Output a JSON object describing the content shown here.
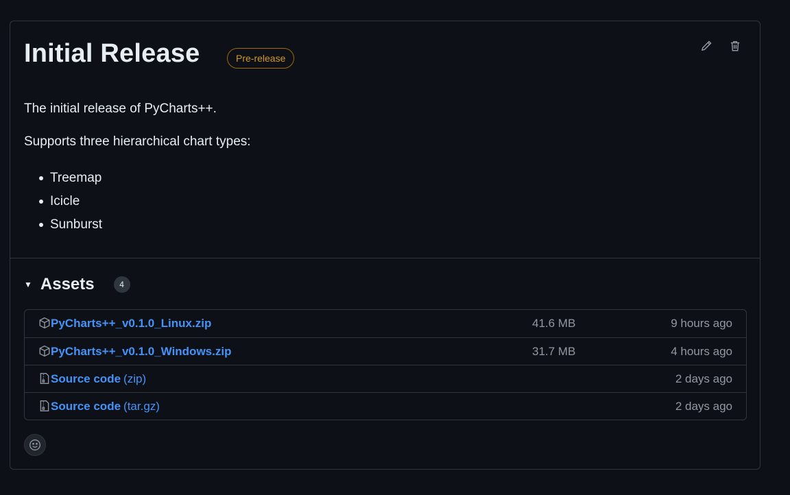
{
  "release": {
    "title": "Initial Release",
    "badge": "Pre-release",
    "description": "The initial release of PyCharts++.",
    "supports_text": "Supports three hierarchical chart types:",
    "chart_types": [
      "Treemap",
      "Icicle",
      "Sunburst"
    ]
  },
  "assets": {
    "heading": "Assets",
    "count": "4",
    "items": [
      {
        "icon": "package-icon",
        "name": "PyCharts++_v0.1.0_Linux.zip",
        "suffix": "",
        "size": "41.6 MB",
        "time": "9 hours ago"
      },
      {
        "icon": "package-icon",
        "name": "PyCharts++_v0.1.0_Windows.zip",
        "suffix": "",
        "size": "31.7 MB",
        "time": "4 hours ago"
      },
      {
        "icon": "file-zip-icon",
        "name": "Source code",
        "suffix": "(zip)",
        "size": "",
        "time": "2 days ago"
      },
      {
        "icon": "file-zip-icon",
        "name": "Source code",
        "suffix": "(tar.gz)",
        "size": "",
        "time": "2 days ago"
      }
    ]
  },
  "colors": {
    "background": "#0d1117",
    "border": "#30363d",
    "link": "#4493f8",
    "muted": "#9198a1",
    "prerelease": "#d29922"
  }
}
